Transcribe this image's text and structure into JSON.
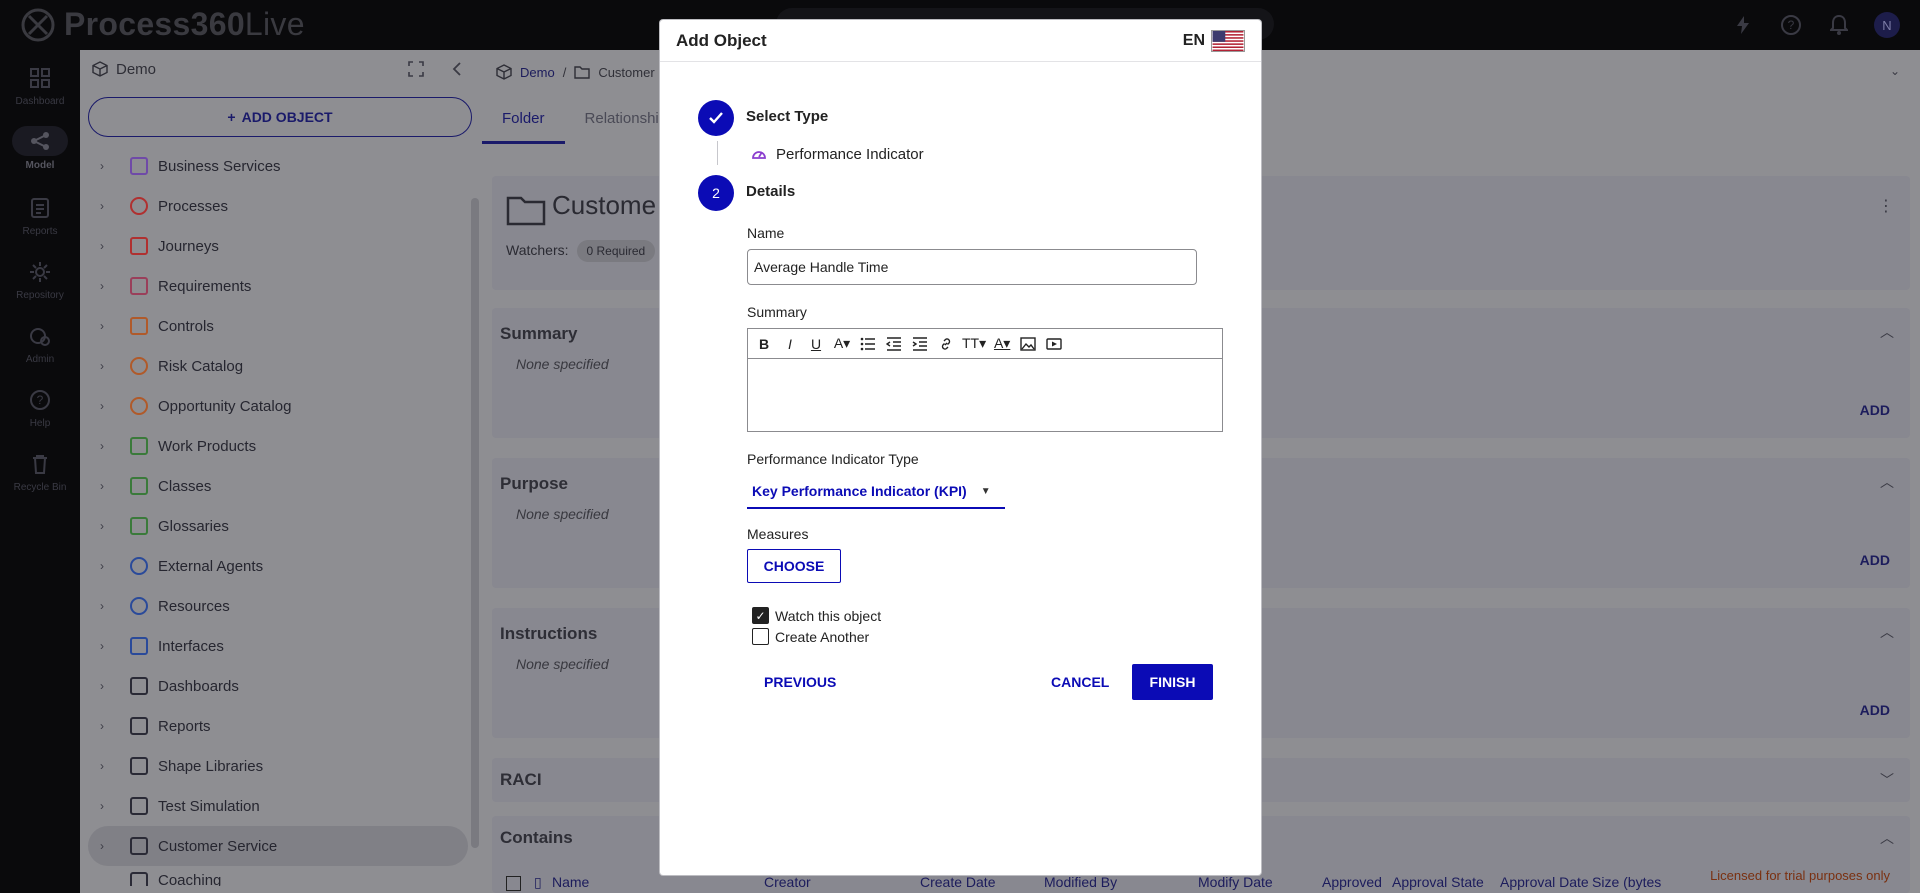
{
  "app": {
    "name_main": "Process360",
    "name_suffix": "Live",
    "avatar_initial": "N"
  },
  "rail": [
    {
      "label": "Dashboard",
      "icon": "dashboard-icon"
    },
    {
      "label": "Model",
      "icon": "model-icon"
    },
    {
      "label": "Reports",
      "icon": "reports-icon"
    },
    {
      "label": "Repository",
      "icon": "repository-icon"
    },
    {
      "label": "Admin",
      "icon": "admin-icon"
    },
    {
      "label": "Help",
      "icon": "help-icon"
    },
    {
      "label": "Recycle Bin",
      "icon": "trash-icon"
    }
  ],
  "tree": {
    "title": "Demo",
    "add_label": "ADD OBJECT",
    "items": [
      {
        "label": "Business Services",
        "color": "#6f4aa8"
      },
      {
        "label": "Processes",
        "color": "#b03030"
      },
      {
        "label": "Journeys",
        "color": "#b03030"
      },
      {
        "label": "Requirements",
        "color": "#9a3f5a"
      },
      {
        "label": "Controls",
        "color": "#b05a2a"
      },
      {
        "label": "Risk Catalog",
        "color": "#b05a2a"
      },
      {
        "label": "Opportunity Catalog",
        "color": "#b05a2a"
      },
      {
        "label": "Work Products",
        "color": "#3a7a3a"
      },
      {
        "label": "Classes",
        "color": "#3a7a3a"
      },
      {
        "label": "Glossaries",
        "color": "#3a7a3a"
      },
      {
        "label": "External Agents",
        "color": "#2a4a9a"
      },
      {
        "label": "Resources",
        "color": "#2a4a9a"
      },
      {
        "label": "Interfaces",
        "color": "#2a4a9a"
      },
      {
        "label": "Dashboards",
        "color": "#2a2a36"
      },
      {
        "label": "Reports",
        "color": "#2a2a36"
      },
      {
        "label": "Shape Libraries",
        "color": "#2a2a36"
      },
      {
        "label": "Test Simulation",
        "color": "#2a2a36"
      },
      {
        "label": "Customer Service",
        "color": "#2a2a36"
      },
      {
        "label": "Coaching",
        "color": "#2a2a36"
      }
    ]
  },
  "main": {
    "crumbs": [
      "Demo",
      "/",
      "Customer"
    ],
    "tabs": [
      "Folder",
      "Relationships"
    ],
    "folder_title": "Custome",
    "watchers_label": "Watchers:",
    "watchers_chip": "0 Required",
    "sections": [
      {
        "title": "Summary",
        "none": "None specified",
        "add": "ADD"
      },
      {
        "title": "Purpose",
        "none": "None specified",
        "add": "ADD"
      },
      {
        "title": "Instructions",
        "none": "None specified",
        "add": "ADD"
      },
      {
        "title": "RACI"
      },
      {
        "title": "Contains"
      }
    ],
    "table_columns": [
      "Name",
      "Creator",
      "Create Date",
      "Modified By",
      "Modify Date",
      "Approved",
      "Approval State",
      "Approval Date",
      "Size (bytes"
    ],
    "license": "Licensed for trial purposes only"
  },
  "modal": {
    "title": "Add Object",
    "lang": "EN",
    "step1": {
      "label": "Select Type",
      "selected": "Performance Indicator"
    },
    "step2": {
      "number": "2",
      "label": "Details"
    },
    "name_label": "Name",
    "name_value": "Average Handle Time",
    "summary_label": "Summary",
    "pi_type_label": "Performance Indicator Type",
    "pi_type_value": "Key Performance Indicator (KPI)",
    "measures_label": "Measures",
    "choose_label": "CHOOSE",
    "watch_label": "Watch this object",
    "watch_checked": true,
    "another_label": "Create Another",
    "another_checked": false,
    "previous_label": "PREVIOUS",
    "cancel_label": "CANCEL",
    "finish_label": "FINISH",
    "colors": {
      "primary": "#0b0bb5"
    }
  }
}
